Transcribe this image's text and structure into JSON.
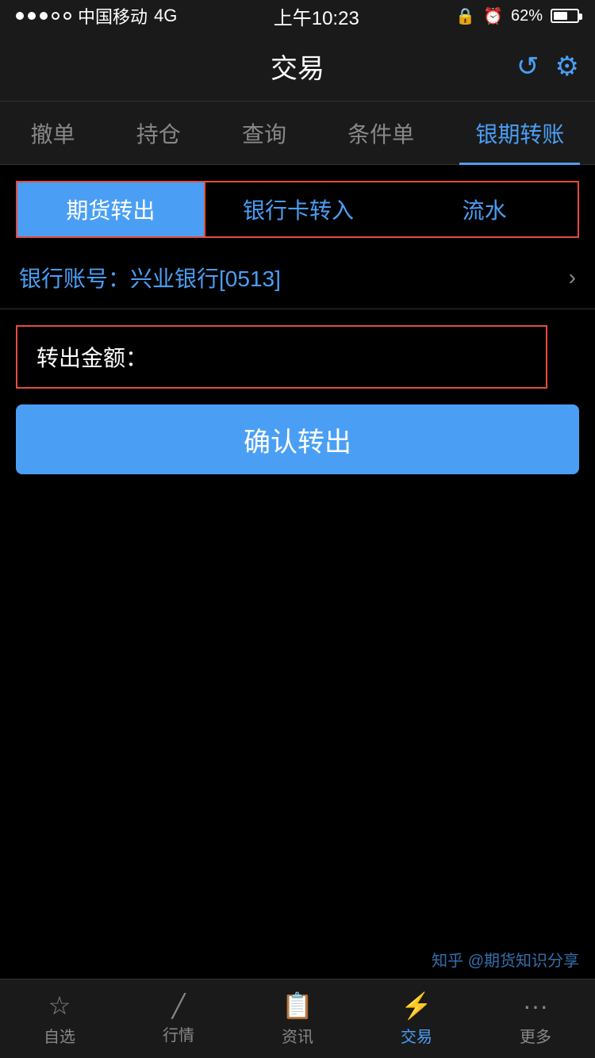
{
  "statusBar": {
    "carrier": "中国移动",
    "network": "4G",
    "time": "上午10:23",
    "battery": "62%"
  },
  "header": {
    "title": "交易",
    "refreshIcon": "↺",
    "settingsIcon": "⚙"
  },
  "topTabs": [
    {
      "label": "撤单",
      "active": false
    },
    {
      "label": "持仓",
      "active": false
    },
    {
      "label": "查询",
      "active": false
    },
    {
      "label": "条件单",
      "active": false
    },
    {
      "label": "银期转账",
      "active": true
    }
  ],
  "subTabs": [
    {
      "label": "期货转出",
      "active": true
    },
    {
      "label": "银行卡转入",
      "active": false
    },
    {
      "label": "流水",
      "active": false
    }
  ],
  "bankAccount": {
    "prefix": "银行账号：兴业银行",
    "suffix": "[0513]"
  },
  "amountField": {
    "label": "转出金额：",
    "value": "",
    "placeholder": ""
  },
  "confirmButton": {
    "label": "确认转出"
  },
  "bottomTabs": [
    {
      "label": "自选",
      "icon": "☆",
      "active": false
    },
    {
      "label": "行情",
      "icon": "📈",
      "active": false
    },
    {
      "label": "资讯",
      "icon": "📄",
      "active": false
    },
    {
      "label": "交易",
      "icon": "⚡",
      "active": true
    },
    {
      "label": "更多",
      "icon": "•••",
      "active": false
    }
  ],
  "watermark": "知乎 @期货知识分享"
}
